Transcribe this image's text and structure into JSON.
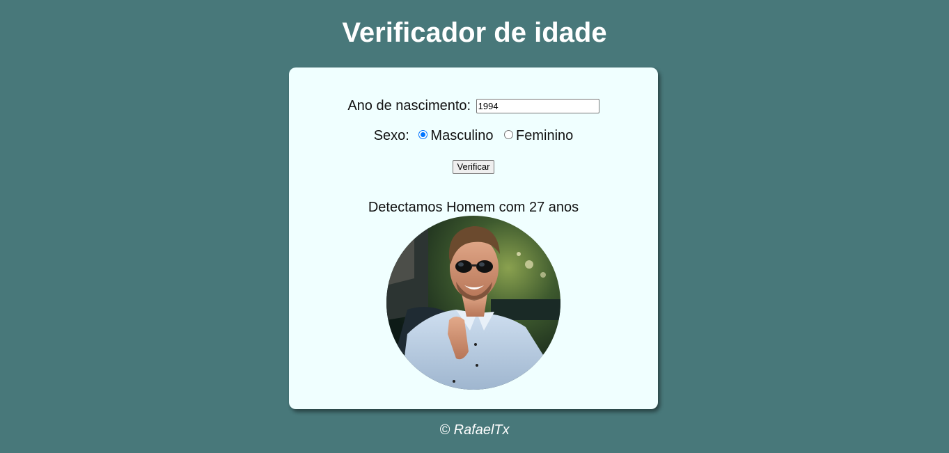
{
  "page": {
    "title": "Verificador de idade",
    "footer": "© RafaelTx",
    "background_color": "#48787a",
    "card_color": "#f0ffff"
  },
  "form": {
    "year_label": "Ano de nascimento:",
    "year_value": "1994",
    "sex_label": "Sexo:",
    "sex_options": [
      {
        "label": "Masculino",
        "selected": true
      },
      {
        "label": "Feminino",
        "selected": false
      }
    ],
    "submit_label": "Verificar"
  },
  "result": {
    "text": "Detectamos Homem com 27 anos",
    "photo_icon": "man-photo"
  }
}
